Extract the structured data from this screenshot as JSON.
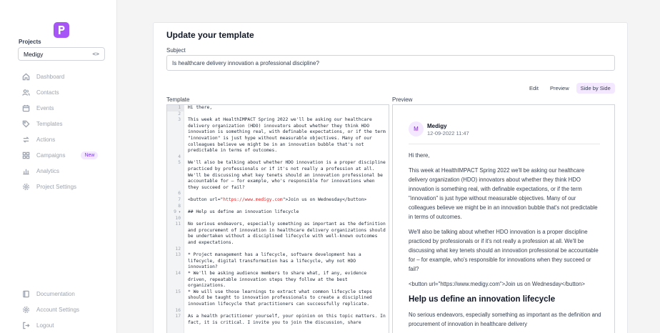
{
  "sidebar": {
    "projects_label": "Projects",
    "project_selected": "Medigy",
    "nav": [
      {
        "label": "Dashboard",
        "icon": "home-icon"
      },
      {
        "label": "Contacts",
        "icon": "users-icon"
      },
      {
        "label": "Events",
        "icon": "calendar-icon"
      },
      {
        "label": "Templates",
        "icon": "tag-icon"
      },
      {
        "label": "Actions",
        "icon": "arrows-icon"
      },
      {
        "label": "Campaigns",
        "icon": "grid-icon",
        "badge": "New"
      },
      {
        "label": "Analytics",
        "icon": "bar-chart-icon"
      },
      {
        "label": "Project Settings",
        "icon": "gear-icon"
      }
    ],
    "bottom_nav": [
      {
        "label": "Documentation",
        "icon": "book-icon"
      },
      {
        "label": "Account Settings",
        "icon": "gear-icon"
      },
      {
        "label": "Logout",
        "icon": "logout-icon"
      }
    ]
  },
  "main": {
    "title": "Update your template",
    "subject_label": "Subject",
    "subject_value": "Is healthcare delivery innovation a professional discipline?",
    "view_tabs": [
      "Edit",
      "Preview",
      "Side by Side"
    ],
    "active_tab": "Side by Side",
    "template_label": "Template",
    "preview_label": "Preview"
  },
  "editor": {
    "lines": [
      {
        "n": "1",
        "text": "Hi there,"
      },
      {
        "n": "2",
        "text": ""
      },
      {
        "n": "3",
        "text": "This week at HealthIMPACT Spring 2022 we'll be asking our healthcare delivery organization (HDO) innovators about whether they think HDO innovation is something real, with definable expectations, or if the term \"innovation\" is just hype without measurable objectives. Many of our colleagues believe we might be in an innovation bubble that's not predictable in terms of outcomes."
      },
      {
        "n": "4",
        "text": ""
      },
      {
        "n": "5",
        "text": "We'll also be talking about whether HDO innovation is a proper discipline practiced by professionals or if it's not really a profession at all. We'll be discussing what key tenets should an innovation professional be accountable for – for example, who's responsible for innovations when they succeed or fail?"
      },
      {
        "n": "6",
        "text": ""
      },
      {
        "n": "7",
        "pre": "<button url=\"",
        "url": "https://www.medigy.com",
        "post": "\">Join us on Wednesday</button>"
      },
      {
        "n": "8",
        "text": ""
      },
      {
        "n": "9",
        "text": "## Help us define an innovation lifecycle",
        "fold": true
      },
      {
        "n": "10",
        "text": ""
      },
      {
        "n": "11",
        "text": "No serious endeavors, especially something as important as the definition and procurement of innovation in healthcare delivery organizations should be undertaken without a disciplined lifecycle with well-known outcomes and expectations."
      },
      {
        "n": "12",
        "text": ""
      },
      {
        "n": "13",
        "text": "* Project management has a lifecycle, software development has a lifecycle, digital transformation has a lifecycle, why not HDO innovation?"
      },
      {
        "n": "14",
        "text": "* We'll be asking audience members to share what, if any, evidence driven, repeatable innovation steps they follow at the best organizations."
      },
      {
        "n": "15",
        "text": "* We will use those learnings to extract what common lifecycle steps should be taught to innovation professionals to create a disciplined innovation lifecycle that practitioners can successfully replicate."
      },
      {
        "n": "16",
        "text": ""
      },
      {
        "n": "17",
        "text": "As a health practitioner yourself, your opinion on this topic matters. In fact, it is critical. I invite you to join the discussion, share"
      }
    ]
  },
  "preview": {
    "avatar_letter": "M",
    "sender": "Medigy",
    "date": "12-09-2022 11:47",
    "greeting": "Hi there,",
    "para1": "This week at HealthIMPACT Spring 2022 we'll be asking our healthcare delivery organization (HDO) innovators about whether they think HDO innovation is something real, with definable expectations, or if the term \"innovation\" is just hype without measurable objectives. Many of our colleagues believe we might be in an innovation bubble that's not predictable in terms of outcomes.",
    "para2": "We'll also be talking about whether HDO innovation is a proper discipline practiced by professionals or if it's not really a profession at all. We'll be discussing what key tenets should an innovation professional be accountable for – for example, who's responsible for innovations when they succeed or fail?",
    "button_line": "<button url=\"https://www.medigy.com\">Join us on Wednesday</button>",
    "heading": "Help us define an innovation lifecycle",
    "para3": "No serious endeavors, especially something as important as the definition and procurement of innovation in healthcare delivery"
  },
  "colors": {
    "brand": "#a855f7",
    "active_tab_bg": "#f3e8ff",
    "url_red": "#dc2626"
  }
}
